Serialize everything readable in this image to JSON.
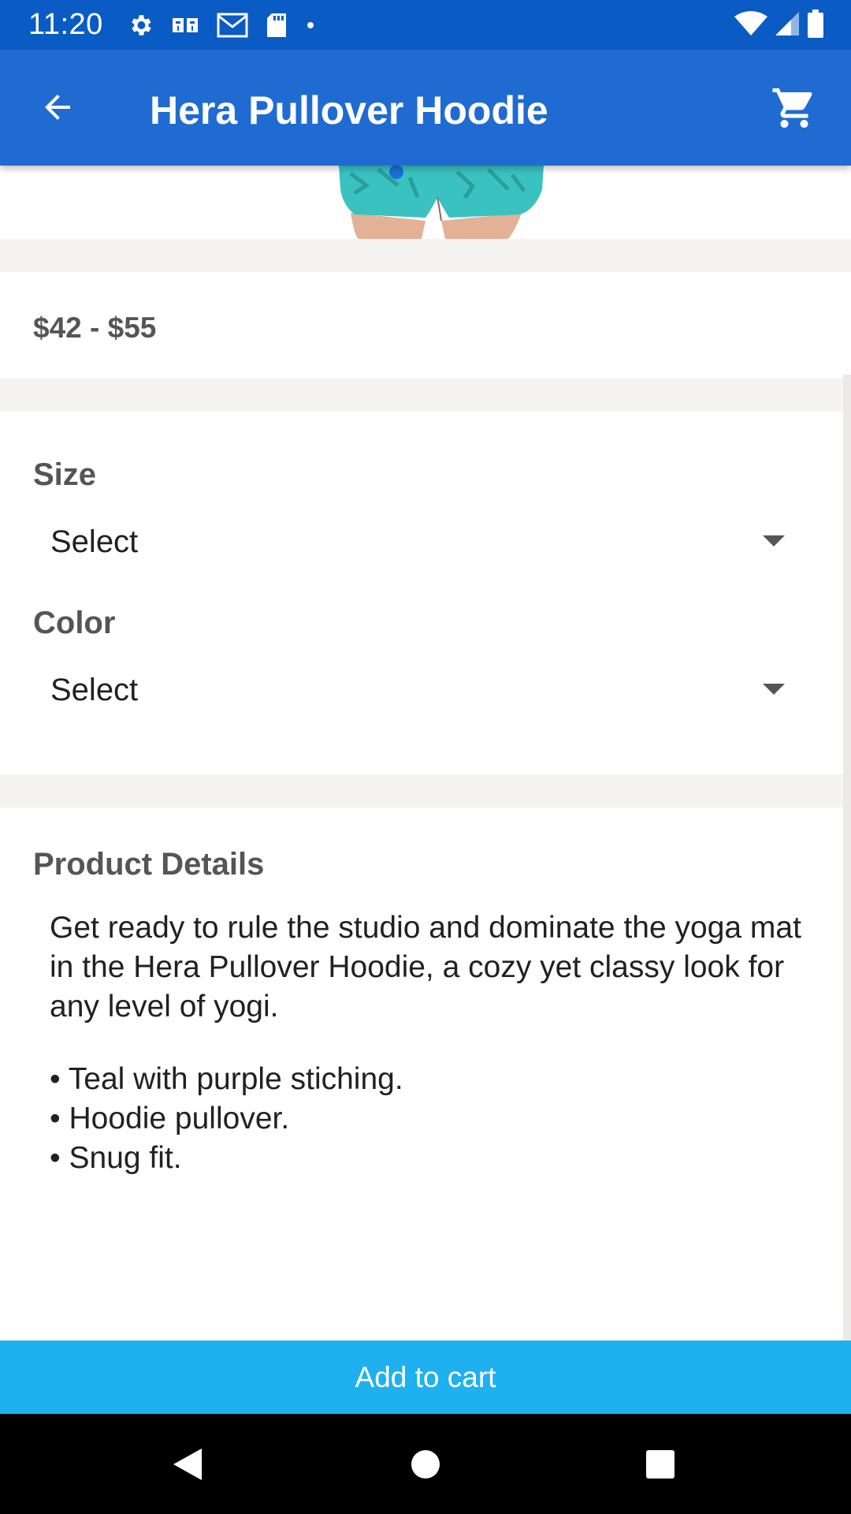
{
  "status_bar": {
    "time": "11:20",
    "left_icons": [
      "gear-icon",
      "app-icon",
      "gmail-icon",
      "sd-card-icon",
      "dot-icon"
    ],
    "right_icons": [
      "wifi-icon",
      "signal-icon",
      "battery-icon"
    ]
  },
  "app_bar": {
    "title": "Hera Pullover Hoodie",
    "back_icon": "arrow-back-icon",
    "cart_icon": "shopping-cart-icon",
    "color": "#1f6bd1"
  },
  "product": {
    "price_range": "$42 - $55"
  },
  "options": {
    "size": {
      "label": "Size",
      "value": "Select"
    },
    "color": {
      "label": "Color",
      "value": "Select"
    }
  },
  "details": {
    "title": "Product Details",
    "description": "Get ready to rule the studio and dominate the yoga mat in the Hera Pullover Hoodie, a cozy yet classy look for any level of yogi.",
    "bullets": [
      "Teal with purple stiching.",
      "Hoodie pullover.",
      "Snug fit."
    ]
  },
  "actions": {
    "add_to_cart": "Add to cart",
    "button_color": "#1fb0f0"
  },
  "nav_bar": {
    "buttons": [
      "nav-back-icon",
      "nav-home-icon",
      "nav-recents-icon"
    ]
  }
}
